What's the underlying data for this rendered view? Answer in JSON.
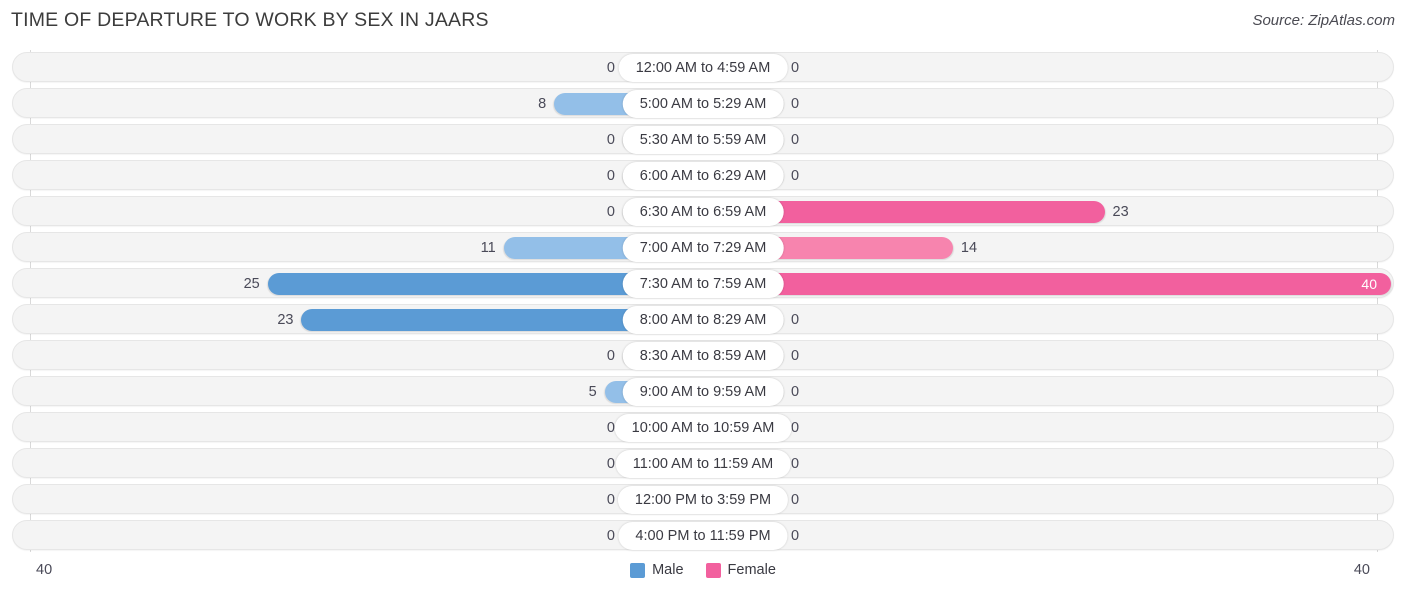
{
  "header": {
    "title": "TIME OF DEPARTURE TO WORK BY SEX IN JAARS",
    "source": "Source: ZipAtlas.com"
  },
  "legend": {
    "male": {
      "label": "Male",
      "color": "#5b9bd5"
    },
    "female": {
      "label": "Female",
      "color": "#f2609e"
    }
  },
  "axis": {
    "left_max": "40",
    "right_max": "40"
  },
  "colors": {
    "male_zero": "#a8cbeb",
    "male_low": "#93bfe8",
    "male_mid": "#7cb1e3",
    "male_high": "#5b9bd5",
    "female_zero": "#f7aec9",
    "female_low": "#f79fbe",
    "female_mid": "#f784ae",
    "female_high": "#f2609e",
    "row_bg": "#f4f4f4",
    "row_border": "#e6e6e6",
    "axis_line": "#d9d9d9"
  },
  "chart_data": {
    "type": "bar",
    "title": "TIME OF DEPARTURE TO WORK BY SEX IN JAARS",
    "orientation": "horizontal-diverging",
    "xlabel": "",
    "ylabel": "",
    "xlim": [
      40,
      40
    ],
    "grid": false,
    "legend_position": "bottom-center",
    "categories": [
      "12:00 AM to 4:59 AM",
      "5:00 AM to 5:29 AM",
      "5:30 AM to 5:59 AM",
      "6:00 AM to 6:29 AM",
      "6:30 AM to 6:59 AM",
      "7:00 AM to 7:29 AM",
      "7:30 AM to 7:59 AM",
      "8:00 AM to 8:29 AM",
      "8:30 AM to 8:59 AM",
      "9:00 AM to 9:59 AM",
      "10:00 AM to 10:59 AM",
      "11:00 AM to 11:59 AM",
      "12:00 PM to 3:59 PM",
      "4:00 PM to 11:59 PM"
    ],
    "series": [
      {
        "name": "Male",
        "color": "#5b9bd5",
        "values": [
          0,
          8,
          0,
          0,
          0,
          11,
          25,
          23,
          0,
          5,
          0,
          0,
          0,
          0
        ]
      },
      {
        "name": "Female",
        "color": "#f2609e",
        "values": [
          0,
          0,
          0,
          0,
          23,
          14,
          40,
          0,
          0,
          0,
          0,
          0,
          0,
          0
        ]
      }
    ]
  }
}
